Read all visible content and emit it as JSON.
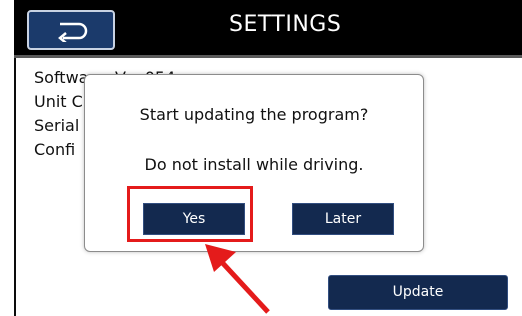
{
  "header": {
    "title": "SETTINGS",
    "back_icon": "return-arrow-icon"
  },
  "info": {
    "lines": [
      "Software: Ver.054",
      "Unit C",
      "Serial",
      "Confi"
    ]
  },
  "dialog": {
    "message": "Start updating the program?",
    "warning": "Do not install while driving.",
    "yes_label": "Yes",
    "later_label": "Later"
  },
  "footer": {
    "update_label": "Update"
  },
  "colors": {
    "accent": "#13294f",
    "highlight": "#e41b1b",
    "titlebar": "#000000"
  }
}
